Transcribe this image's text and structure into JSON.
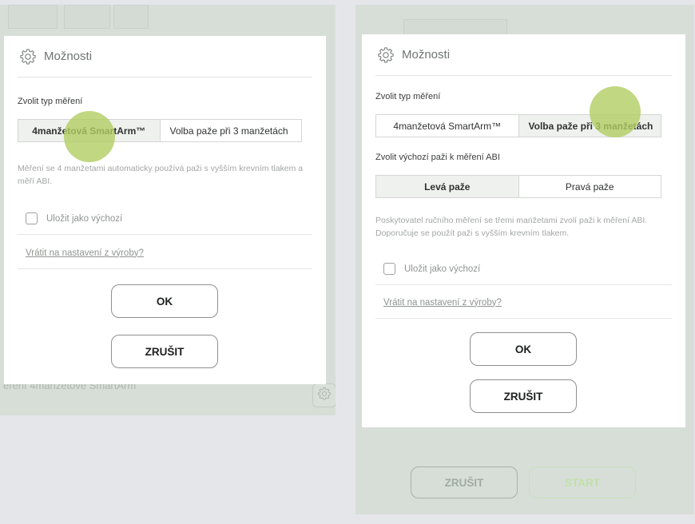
{
  "dialog_left": {
    "title": "Možnosti",
    "measure_type_label": "Zvolit typ měření",
    "segment": [
      "4manžetová SmartArm™",
      "Volba paže při 3 manžetách"
    ],
    "description": "Měření se 4 manžetami automaticky používá paži s vyšším krevním tlakem a měří ABI.",
    "save_default_label": "Uložit jako výchozí",
    "reset_link": "Vrátit na nastavení z výroby?",
    "ok_label": "OK",
    "cancel_label": "ZRUŠIT"
  },
  "dialog_right": {
    "title": "Možnosti",
    "measure_type_label": "Zvolit typ měření",
    "segment": [
      "4manžetová SmartArm™",
      "Volba paže při 3 manžetách"
    ],
    "arm_label": "Zvolit výchozí paži k měření ABI",
    "arm_segment": [
      "Levá paže",
      "Pravá paže"
    ],
    "description": "Poskytovatel ručního měření se třemi manžetami zvolí paži k měření ABI. Doporučuje se použít paži s vyšším krevním tlakem.",
    "save_default_label": "Uložit jako výchozí",
    "reset_link": "Vrátit na nastavení z výroby?",
    "ok_label": "OK",
    "cancel_label": "ZRUŠIT"
  },
  "background_left": {
    "caption": "ěření 4manžetové SmartArm"
  },
  "background_right": {
    "cancel_label": "ZRUŠIT",
    "start_label": "START"
  },
  "colors": {
    "overlay": "#d7ded8",
    "touch_indicator": "#b2cd62",
    "start_text": "#c2e0a8",
    "start_border": "#c7e0b8"
  },
  "icons": {
    "settings": "gear-icon"
  }
}
